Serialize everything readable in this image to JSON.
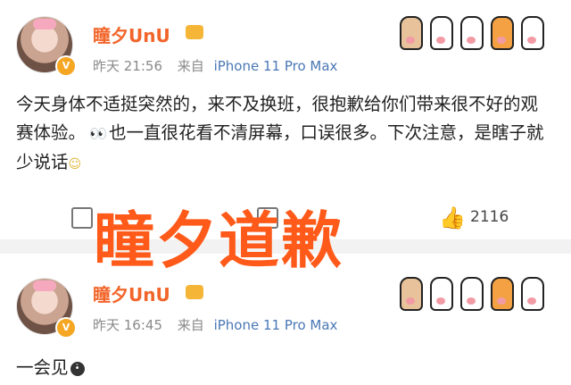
{
  "posts": [
    {
      "username": "瞳夕UnU",
      "time": "昨天 21:56",
      "from_label": "来自",
      "device": "iPhone 11 Pro Max",
      "text_part1": "今天身体不适挺突然的，来不及换班，很抱歉给你们带来很不好的观赛体验。",
      "eyes_emoji": "👀",
      "text_part2": "也一直很花看不清屏幕，口误很多。下次注意，是瞎子就少说话",
      "like_count": "2116"
    },
    {
      "username": "瞳夕UnU",
      "time": "昨天 16:45",
      "from_label": "来自",
      "device": "iPhone 11 Pro Max",
      "text": "一会见"
    }
  ],
  "overlay_title": "瞳夕道歉",
  "colors": {
    "username": "#f2652a",
    "overlay": "#ff5a1a",
    "source_link": "#4a78b5"
  },
  "icons": [
    "avatar",
    "verified-badge",
    "vip-icon",
    "cat-paw-decoration",
    "share-icon",
    "comment-icon",
    "like-icon"
  ]
}
